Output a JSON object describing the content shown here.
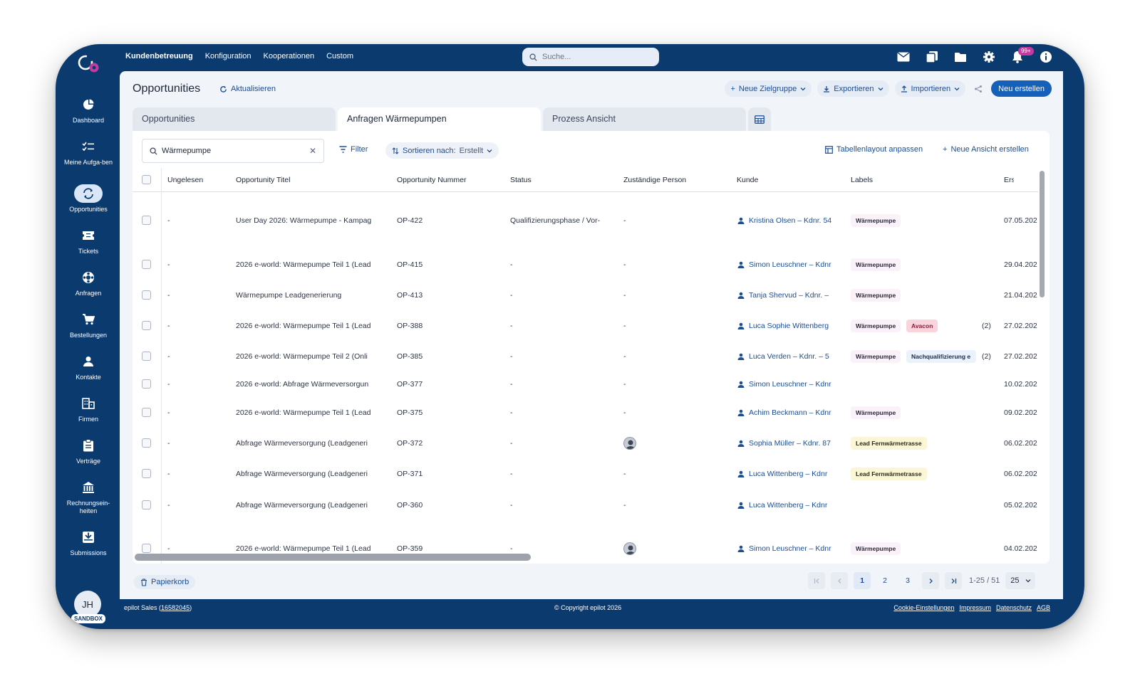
{
  "topnav": {
    "items": [
      "Kundenbetreuung",
      "Konfiguration",
      "Kooperationen",
      "Custom"
    ],
    "search_placeholder": "Suche...",
    "notification_count": "99+"
  },
  "sidebar": {
    "items": [
      {
        "label": "Dashboard",
        "icon": "dashboard-icon"
      },
      {
        "label": "Meine Aufga-ben",
        "icon": "tasks-icon"
      },
      {
        "label": "Opportunities",
        "icon": "opportunities-icon"
      },
      {
        "label": "Tickets",
        "icon": "tickets-icon"
      },
      {
        "label": "Anfragen",
        "icon": "anfragen-icon"
      },
      {
        "label": "Bestellungen",
        "icon": "cart-icon"
      },
      {
        "label": "Kontakte",
        "icon": "person-icon"
      },
      {
        "label": "Firmen",
        "icon": "building-icon"
      },
      {
        "label": "Verträge",
        "icon": "clipboard-icon"
      },
      {
        "label": "Rechnungsein-heiten",
        "icon": "bank-icon"
      },
      {
        "label": "Submissions",
        "icon": "inbox-icon"
      }
    ],
    "avatar_initials": "JH",
    "sandbox_label": "SANDBOX"
  },
  "header": {
    "title": "Opportunities",
    "refresh_label": "Aktualisieren",
    "new_target_group": "Neue Zielgruppe",
    "export": "Exportieren",
    "import": "Importieren",
    "create_new": "Neu erstellen"
  },
  "tabs": [
    "Opportunities",
    "Anfragen Wärmepumpen",
    "Prozess Ansicht"
  ],
  "filters": {
    "search_value": "Wärmepumpe",
    "filter_label": "Filter",
    "sort_label": "Sortieren nach:",
    "sort_value": "Erstellt",
    "table_layout": "Tabellenlayout anpassen",
    "new_view": "Neue Ansicht erstellen"
  },
  "table": {
    "headers": [
      "Ungelesen",
      "Opportunity Titel",
      "Opportunity Nummer",
      "Status",
      "Zuständige Person",
      "Kunde",
      "Labels",
      "Ers"
    ],
    "rows": [
      {
        "unread": "-",
        "title": "User Day 2026: Wärmepumpe - Kampag",
        "number": "OP-422",
        "status": "Qualifizierungsphase / Vor-",
        "person": "-",
        "customer": "Kristina Olsen – Kdnr. 54",
        "labels": [
          "Wärmepumpe"
        ],
        "count": "",
        "created": "07.05.202"
      },
      {
        "unread": "-",
        "title": "2026 e-world: Wärmepumpe Teil 1 (Lead",
        "number": "OP-415",
        "status": "-",
        "person": "-",
        "customer": "Simon Leuschner – Kdnr",
        "labels": [
          "Wärmepumpe"
        ],
        "count": "",
        "created": "29.04.202"
      },
      {
        "unread": "-",
        "title": "Wärmepumpe Leadgenerierung",
        "number": "OP-413",
        "status": "-",
        "person": "-",
        "customer": "Tanja Shervud – Kdnr. –",
        "labels": [
          "Wärmepumpe"
        ],
        "count": "",
        "created": "21.04.202"
      },
      {
        "unread": "-",
        "title": "2026 e-world: Wärmepumpe Teil 1 (Lead",
        "number": "OP-388",
        "status": "-",
        "person": "-",
        "customer": "Luca Sophie Wittenberg",
        "labels": [
          "Wärmepumpe",
          "Avacon"
        ],
        "count": "(2)",
        "created": "27.02.202"
      },
      {
        "unread": "-",
        "title": "2026 e-world: Wärmepumpe Teil 2 (Onli",
        "number": "OP-385",
        "status": "-",
        "person": "-",
        "customer": "Luca Verden – Kdnr. – 5",
        "labels": [
          "Wärmepumpe",
          "Nachqualifizierung e"
        ],
        "count": "(2)",
        "created": "27.02.202"
      },
      {
        "unread": "-",
        "title": "2026 e-world: Abfrage Wärmeversorgun",
        "number": "OP-377",
        "status": "-",
        "person": "-",
        "customer": "Simon Leuschner – Kdnr",
        "labels": [],
        "count": "",
        "created": "10.02.202"
      },
      {
        "unread": "-",
        "title": "2026 e-world: Wärmepumpe Teil 1 (Lead",
        "number": "OP-375",
        "status": "-",
        "person": "-",
        "customer": "Achim Beckmann – Kdnr",
        "labels": [
          "Wärmepumpe"
        ],
        "count": "",
        "created": "09.02.202"
      },
      {
        "unread": "-",
        "title": "Abfrage Wärmeversorgung (Leadgeneri",
        "number": "OP-372",
        "status": "-",
        "person": "avatar",
        "customer": "Sophia Müller – Kdnr. 87",
        "labels": [
          "Lead Fernwärmetrasse"
        ],
        "count": "",
        "created": "06.02.202"
      },
      {
        "unread": "-",
        "title": "Abfrage Wärmeversorgung (Leadgeneri",
        "number": "OP-371",
        "status": "-",
        "person": "-",
        "customer": "Luca Wittenberg – Kdnr",
        "labels": [
          "Lead Fernwärmetrasse"
        ],
        "count": "",
        "created": "06.02.202"
      },
      {
        "unread": "-",
        "title": "Abfrage Wärmeversorgung (Leadgeneri",
        "number": "OP-360",
        "status": "-",
        "person": "-",
        "customer": "Luca Wittenberg – Kdnr",
        "labels": [],
        "count": "",
        "created": "05.02.202"
      },
      {
        "unread": "-",
        "title": "2026 e-world: Wärmepumpe Teil 1 (Lead",
        "number": "OP-359",
        "status": "-",
        "person": "avatar",
        "customer": "Simon Leuschner – Kdnr",
        "labels": [
          "Wärmepumpe"
        ],
        "count": "",
        "created": "04.02.202"
      }
    ]
  },
  "bottom": {
    "trash_label": "Papierkorb",
    "pages": [
      "1",
      "2",
      "3"
    ],
    "current_page": "1",
    "range": "1-25 / 51",
    "page_size": "25"
  },
  "footer": {
    "account": "epilot Sales",
    "account_id": "16582045",
    "copyright": "© Copyright epilot 2026",
    "links": [
      "Cookie-Einstellungen",
      "Impressum",
      "Datenschutz",
      "AGB"
    ]
  },
  "colors": {
    "brand_navy": "#0b3a6e",
    "primary_button": "#1560b8",
    "link_blue": "#1b4e93",
    "badge_pink": "#c53aa0"
  }
}
